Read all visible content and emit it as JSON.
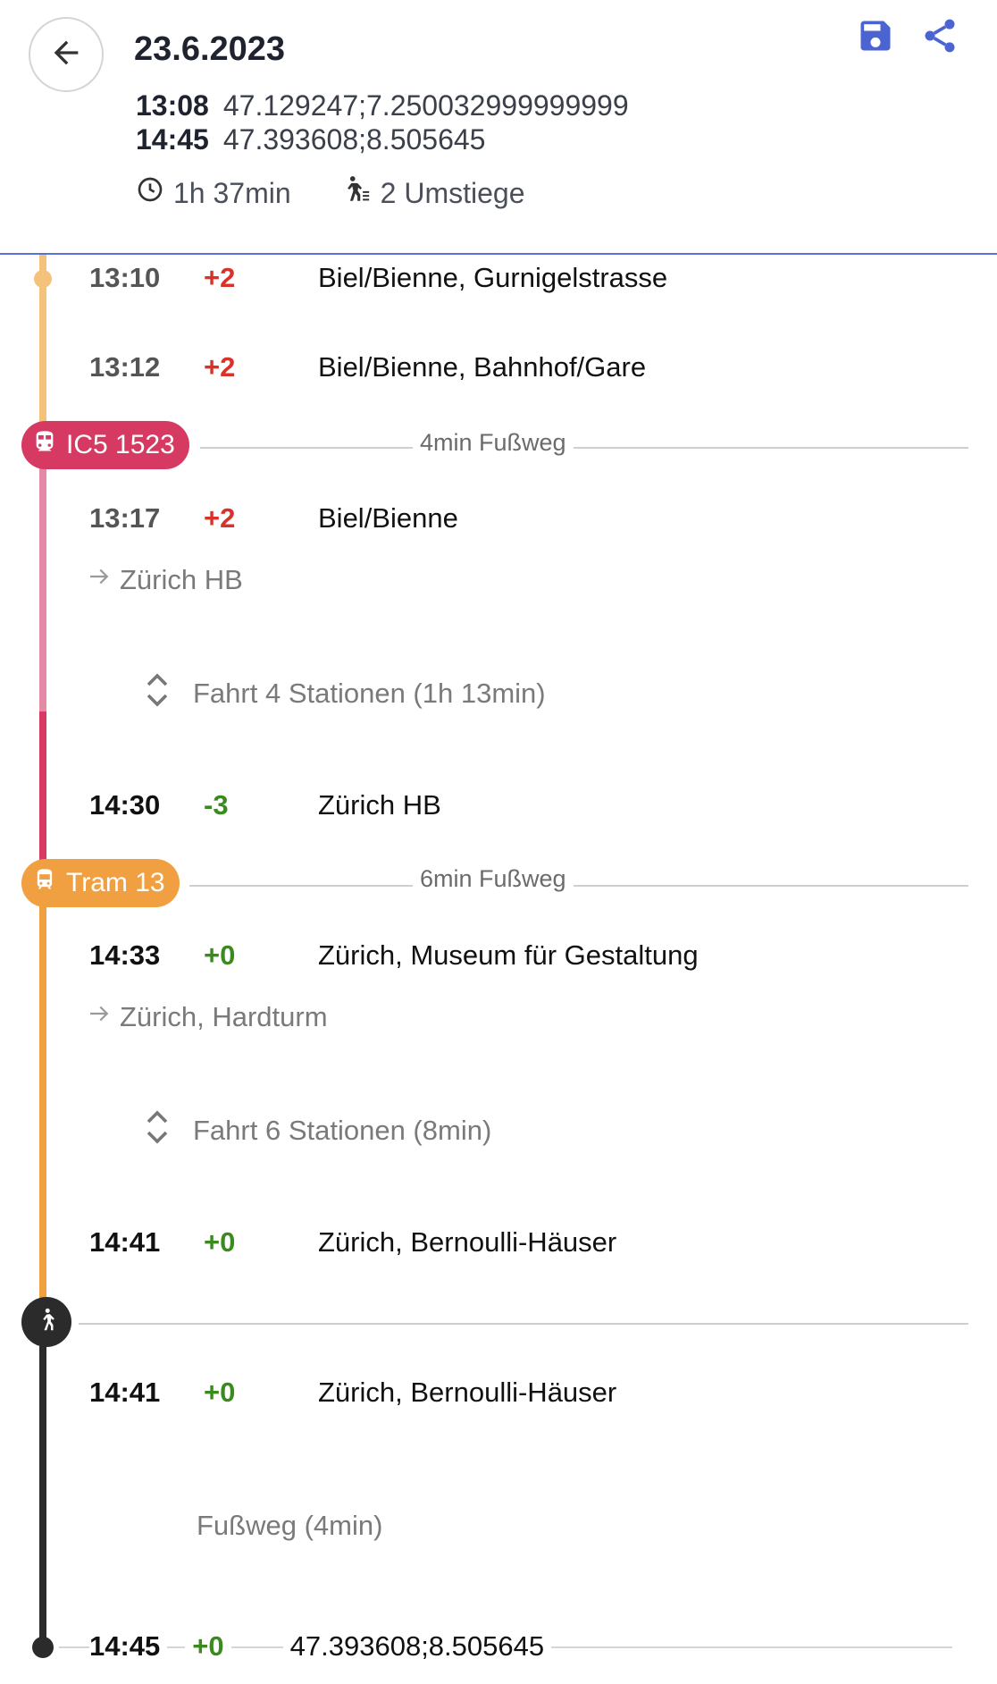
{
  "header": {
    "date": "23.6.2023",
    "departure": {
      "time": "13:08",
      "location": "47.129247;7.250032999999999"
    },
    "arrival": {
      "time": "14:45",
      "location": "47.393608;8.505645"
    },
    "duration": "1h 37min",
    "transfers": "2 Umstiege"
  },
  "icons": {
    "back": "arrow-left-icon",
    "save": "save-icon",
    "share": "share-icon",
    "clock": "clock-icon",
    "transfer": "walk-transfer-icon",
    "train": "train-icon",
    "tram": "tram-icon",
    "walk": "walk-icon",
    "direction": "arrow-right-icon",
    "expand": "expand-icon"
  },
  "colors": {
    "accent": "#5b6fd6",
    "bus_line": "#f4c27a",
    "train": "#d63a63",
    "train_light": "#e58aa6",
    "tram": "#f0a040",
    "walk": "#2b2b2b",
    "delay_positive": "#d8322a",
    "delay_negative": "#3a8a1e"
  },
  "timeline": {
    "first_leg_stops": [
      {
        "time": "13:10",
        "delay": "+2",
        "name": "Biel/Bienne, Gurnigelstrasse"
      },
      {
        "time": "13:12",
        "delay": "+2",
        "name": "Biel/Bienne, Bahnhof/Gare"
      }
    ],
    "train": {
      "badge": "IC5 1523",
      "walk_before": "4min Fußweg",
      "dep": {
        "time": "13:17",
        "delay": "+2",
        "name": "Biel/Bienne"
      },
      "direction": "Zürich HB",
      "expand": "Fahrt 4 Stationen (1h 13min)",
      "arr": {
        "time": "14:30",
        "delay": "-3",
        "name": "Zürich HB"
      }
    },
    "tram": {
      "badge": "Tram 13",
      "walk_before": "6min Fußweg",
      "dep": {
        "time": "14:33",
        "delay": "+0",
        "name": "Zürich, Museum für Gestaltung"
      },
      "direction": "Zürich, Hardturm",
      "expand": "Fahrt 6 Stationen (8min)",
      "arr": {
        "time": "14:41",
        "delay": "+0",
        "name": "Zürich, Bernoulli-Häuser"
      }
    },
    "walk": {
      "dep": {
        "time": "14:41",
        "delay": "+0",
        "name": "Zürich, Bernoulli-Häuser"
      },
      "label": "Fußweg (4min)",
      "arr": {
        "time": "14:45",
        "delay": "+0",
        "name": "47.393608;8.505645"
      }
    }
  }
}
